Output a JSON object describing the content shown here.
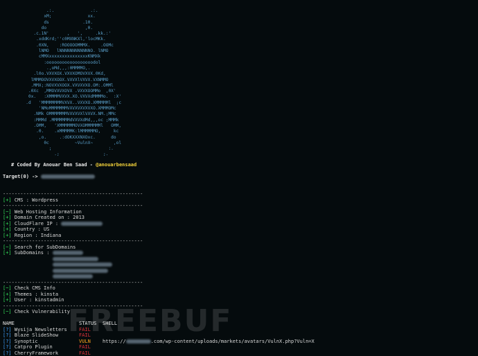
{
  "ascii_art": [
    "                  .:.              .:.",
    "                 xM;              xx.",
    "                 ds             .10.",
    "                do               ,0.",
    "             .c.1N'       ,   ',     .kk.:'",
    "              .xddKrd;''c0MXNKXl,'locMKk.",
    "              .0XN,    :ROOOOOMMMX.    .OOMc",
    "               lNMO   lNNNNNNNNNNNNO. lNMO",
    "               cMMXxxxxxxxxxxxxxxxKNMXk",
    "                 :oooooooooooooooooodol",
    "                  .,oMd,,,:0MMMMO,.",
    "             .l0o.VXVXOX.VXVXOMOVXVX.0Kd,",
    "            lMMMOOVXVXOOX.VXVXlVXVX.VXNMMO",
    "            .MMX;:NOVXVXOOX.VXVXVXO.OM:.OMMl",
    "           .0Xc  ,MMOVXVXOVX .VXVXOOMMo  ,0X'",
    "           0x.   :XMMMMVXVX.XO.VXVXdMMMMo.  :X'",
    "          .d   'MMMMMMMMVXVX..VXVXO.XMMMMMl  ;c",
    "               'NMoMMMMMMMVXVXVXVXVXO.XMMMOMc",
    "             .NMk OMMMMMMMVXVXVXlVXVX.NM.;MMc",
    "             :MMMd .MMMMMMMdVXVXdMd,,,oc ;MMMk",
    "             .OMM,   'XMMMMMMOVXOMMMMMMl   OMM,",
    "              .0.    .xMMMMMK:lMMMMMMO,     kc",
    "               ,o.     .:dOKXXXNXOxc.      do",
    "                 0c          ~VulnX~        ,ol",
    "                   ;                      :.",
    "                     .;                 ;."
  ],
  "credit": {
    "prefix": "# Coded By Anouar Ben Saad -",
    "handle": "@anouarbensaad"
  },
  "target": {
    "label": "Target(0) ->"
  },
  "separator": "----------------------------------------------------------------------",
  "cms": {
    "tag": "[+]",
    "text": "CMS : Wordpress"
  },
  "hosting": [
    {
      "tag": "[~]",
      "text": "Web Hosting Information"
    },
    {
      "tag": "[+]",
      "text": "Domain Created on : 2013"
    },
    {
      "tag": "[+]",
      "text": "CloudFlare IP :"
    },
    {
      "tag": "[+]",
      "text": "Country : US"
    },
    {
      "tag": "[+]",
      "text": "Region : Indiana"
    }
  ],
  "subdomains": {
    "search": {
      "tag": "[~]",
      "text": "Search for SubDomains"
    },
    "list": {
      "tag": "[+]",
      "text": "SubDomains :"
    }
  },
  "cms_info": [
    {
      "tag": "[~]",
      "text": "Check CMS Info"
    },
    {
      "tag": "[+]",
      "text": "Themes : kinsta"
    },
    {
      "tag": "[+]",
      "text": "User : kinstadmin"
    }
  ],
  "vuln_check": {
    "tag": "[~]",
    "text": "Check Vulnerability"
  },
  "table": {
    "headers": {
      "name": "NAME",
      "status": "STATUS",
      "shell": "SHELL"
    },
    "rows": [
      {
        "q": "[?]",
        "name": "Wysija Newsletters",
        "status": "FAIL",
        "shell": ""
      },
      {
        "q": "[?]",
        "name": "Blaze SlideShow",
        "status": "FAIL",
        "shell": ""
      },
      {
        "q": "[?]",
        "name": "Synoptic",
        "status": "VULN",
        "shell": "https://",
        "shell_rest": ".com/wp-content/uploads/markets/avatars/VulnX.php?Vuln=X"
      },
      {
        "q": "[?]",
        "name": "Catpro Plugin",
        "status": "FAIL",
        "shell": ""
      },
      {
        "q": "[?]",
        "name": "CherryFramework",
        "status": "FAIL",
        "shell": ""
      }
    ]
  },
  "watermark": "FREEBUF",
  "colors": {
    "background": "#050b0d",
    "ascii": "#5a9fc9",
    "success_tag": "#34e05a",
    "question_tag": "#3fa0ff",
    "fail": "#e0323a",
    "vuln": "#ffa51f",
    "handle": "#f2d13a"
  }
}
